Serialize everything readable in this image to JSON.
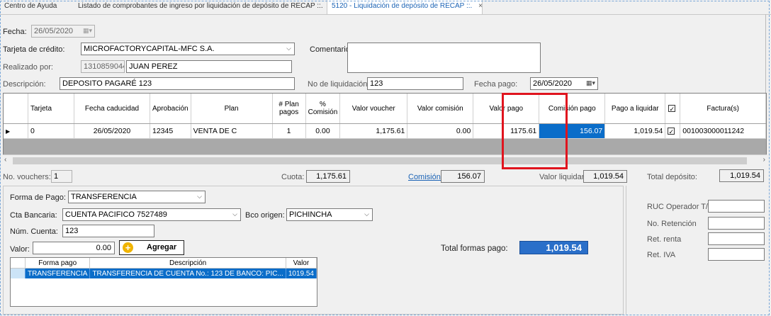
{
  "tabs": [
    {
      "label": "Centro de Ayuda"
    },
    {
      "label": "Listado de comprobantes de ingreso por liquidación de depósito de RECAP ::."
    },
    {
      "label": "5120 - Liquidación de depósito de RECAP ::.",
      "close": "×"
    }
  ],
  "header": {
    "fecha_label": "Fecha:",
    "fecha_value": "26/05/2020",
    "tarjeta_label": "Tarjeta de crédito:",
    "tarjeta_value": "MICROFACTORYCAPITAL-MFC S.A.",
    "comentario_label": "Comentario:",
    "comentario_value": "",
    "realizado_label": "Realizado por:",
    "realizado_id": "1310859044",
    "realizado_name": "JUAN PEREZ",
    "descripcion_label": "Descripción:",
    "descripcion_value": "DEPOSITO PAGARÉ 123",
    "liquidacion_label": "No de liquidación:",
    "liquidacion_value": "123",
    "fecha_pago_label": "Fecha pago:",
    "fecha_pago_value": "26/05/2020"
  },
  "grid": {
    "columns": [
      "Tarjeta",
      "Fecha caducidad",
      "Aprobación",
      "Plan",
      "# Plan pagos",
      "% Comisión",
      "Valor voucher",
      "Valor comisión",
      "Valor pago",
      "Comisión pago",
      "Pago a liquidar",
      "",
      "Factura(s)"
    ],
    "rows": [
      {
        "tarjeta": "0",
        "fecha_caducidad": "26/05/2020",
        "aprobacion": "12345",
        "plan": "VENTA DE C",
        "plan_pagos": "1",
        "comision_pct": "0.00",
        "valor_voucher": "1,175.61",
        "valor_comision": "0.00",
        "valor_pago": "1175.61",
        "comision_pago": "156.07",
        "pago_liquidar": "1,019.54",
        "factura": "001003000011242"
      }
    ]
  },
  "summary": {
    "vouchers_label": "No. vouchers:",
    "vouchers_value": "1",
    "cuota_label": "Cuota:",
    "cuota_value": "1,175.61",
    "comision_label": "Comisión:",
    "comision_value": "156.07",
    "valor_liquidar_label": "Valor liquidar:",
    "valor_liquidar_value": "1,019.54",
    "total_deposito_label": "Total depósito:",
    "total_deposito_value": "1,019.54"
  },
  "payment": {
    "forma_label": "Forma de Pago:",
    "forma_value": "TRANSFERENCIA",
    "cta_label": "Cta Bancaria:",
    "cta_value": "CUENTA PACIFICO 7527489",
    "bco_label": "Bco origen:",
    "bco_value": "PICHINCHA",
    "num_cuenta_label": "Núm. Cuenta:",
    "num_cuenta_value": "123",
    "valor_label": "Valor:",
    "valor_value": "0.00",
    "agregar_label": "Agregar",
    "total_formas_label": "Total formas pago:",
    "total_formas_value": "1,019.54",
    "grid_columns": [
      "Forma pago",
      "Descripción",
      "Valor"
    ],
    "grid_rows": [
      {
        "forma": "TRANSFERENCIA",
        "descripcion": "TRANSFERENCIA DE CUENTA No.: 123 DE BANCO: PIC...",
        "valor": "1019.54"
      }
    ]
  },
  "right_panel": {
    "ruc_label": "RUC Operador T/C",
    "retencion_label": "No. Retención",
    "ret_renta_label": "Ret. renta",
    "ret_iva_label": "Ret. IVA"
  },
  "colors": {
    "selection": "#0a6dc9",
    "highlight": "#e0141e",
    "link": "#1b63b5"
  }
}
